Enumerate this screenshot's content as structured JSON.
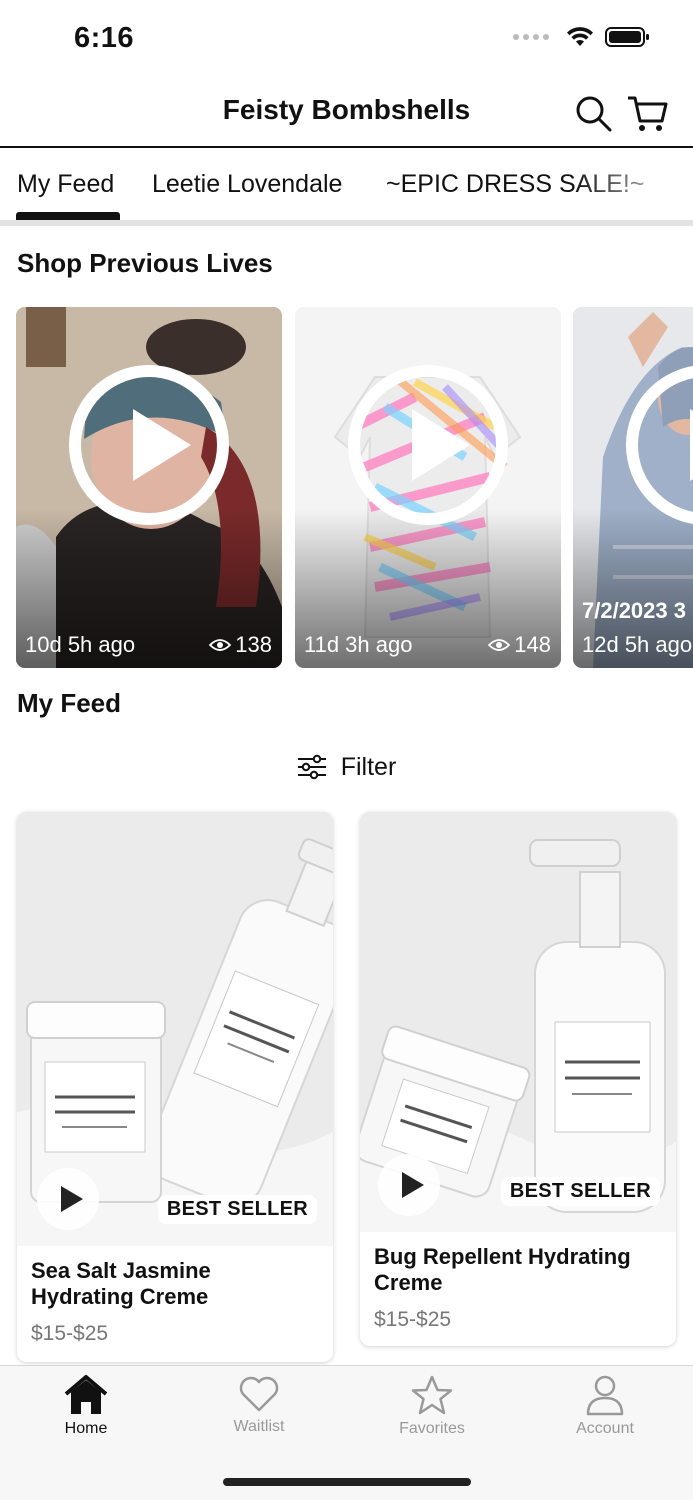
{
  "status_bar": {
    "time": "6:16"
  },
  "header": {
    "title": "Feisty Bombshells"
  },
  "tabs": [
    {
      "label": "My Feed",
      "active": true
    },
    {
      "label": "Leetie Lovendale",
      "active": false
    },
    {
      "label": "~EPIC DRESS SALE!~",
      "active": false
    }
  ],
  "shop_previous_lives": {
    "title": "Shop Previous Lives",
    "cards": [
      {
        "time": "10d 5h ago",
        "views": "138"
      },
      {
        "time": "11d 3h ago",
        "views": "148"
      },
      {
        "date_label": "7/2/2023 3",
        "time": "12d 5h ago"
      }
    ]
  },
  "my_feed": {
    "title": "My Feed",
    "filter_label": "Filter",
    "products": [
      {
        "name": "Sea Salt Jasmine Hydrating Creme",
        "price": "$15-$25",
        "badge": "BEST SELLER"
      },
      {
        "name": "Bug Repellent Hydrating Creme",
        "price": "$15-$25",
        "badge": "BEST SELLER"
      }
    ]
  },
  "bottom_nav": [
    {
      "label": "Home",
      "icon": "home-icon",
      "active": true
    },
    {
      "label": "Waitlist",
      "icon": "heart-icon",
      "active": false
    },
    {
      "label": "Favorites",
      "icon": "star-icon",
      "active": false
    },
    {
      "label": "Account",
      "icon": "person-icon",
      "active": false
    }
  ],
  "colors": {
    "accent": "#111111",
    "inactive": "#999999",
    "divider": "#e2e2e2"
  }
}
